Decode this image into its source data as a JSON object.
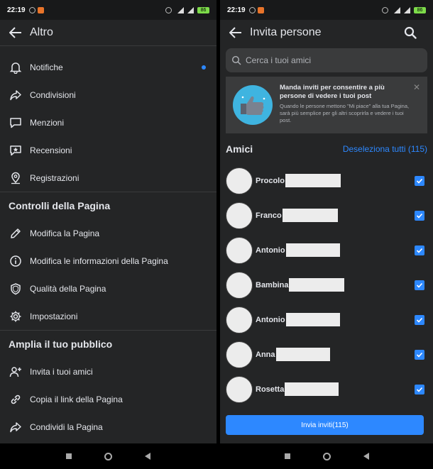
{
  "status_bar": {
    "time": "22:19",
    "battery": "86"
  },
  "left": {
    "title": "Altro",
    "items": [
      {
        "label": "Notifiche",
        "icon": "bell-icon"
      },
      {
        "label": "Condivisioni",
        "icon": "share-icon"
      },
      {
        "label": "Menzioni",
        "icon": "speech-bubble-icon"
      },
      {
        "label": "Recensioni",
        "icon": "star-bubble-icon"
      },
      {
        "label": "Registrazioni",
        "icon": "location-pin-icon"
      }
    ],
    "section_controls": "Controlli della Pagina",
    "controls": [
      {
        "label": "Modifica la Pagina",
        "icon": "pencil-icon"
      },
      {
        "label": "Modifica le informazioni della Pagina",
        "icon": "info-icon"
      },
      {
        "label": "Qualità della Pagina",
        "icon": "shield-icon"
      },
      {
        "label": "Impostazioni",
        "icon": "gear-icon"
      }
    ],
    "section_audience": "Amplia il tuo pubblico",
    "audience": [
      {
        "label": "Invita i tuoi amici",
        "icon": "add-person-icon"
      },
      {
        "label": "Copia il link della Pagina",
        "icon": "link-icon"
      },
      {
        "label": "Condividi la Pagina",
        "icon": "share-icon"
      }
    ]
  },
  "right": {
    "title": "Invita persone",
    "search_placeholder": "Cerca i tuoi amici",
    "banner": {
      "title": "Manda inviti per consentire a più persone di vedere i tuoi post",
      "body": "Quando le persone mettono \"Mi piace\" alla tua Pagina, sarà più semplice per gli altri scoprirla e vedere i tuoi post."
    },
    "friends_title": "Amici",
    "deselect_all": "Deseleziona tutti (115)",
    "friends": [
      {
        "name": "Procolo"
      },
      {
        "name": "Franco"
      },
      {
        "name": "Antonio"
      },
      {
        "name": "Bambina"
      },
      {
        "name": "Antonio"
      },
      {
        "name": "Anna"
      },
      {
        "name": "Rosetta"
      }
    ],
    "send_button": "Invia inviti(115)"
  },
  "colors": {
    "accent": "#2d88ff",
    "background": "#242526",
    "surface": "#3a3b3c"
  }
}
